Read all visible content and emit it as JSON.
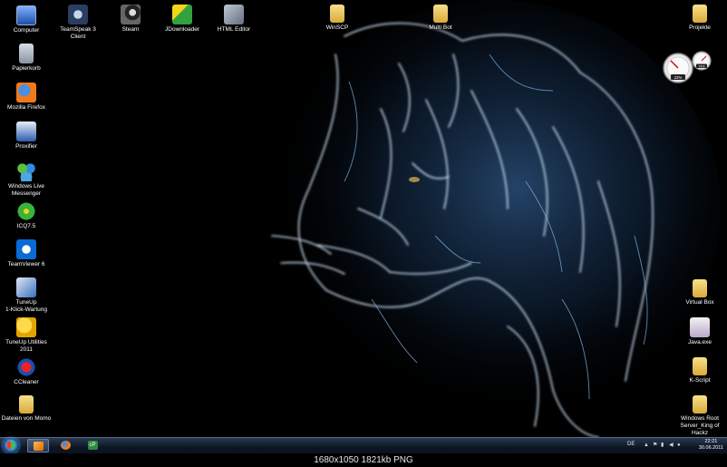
{
  "desktop_icons": [
    {
      "label": "Computer",
      "icon": "computer-icon"
    },
    {
      "label": "Papierkorb",
      "icon": "recycle-bin-icon"
    },
    {
      "label": "Mozilla Firefox",
      "icon": "firefox-icon"
    },
    {
      "label": "Proxifier",
      "icon": "proxifier-icon"
    },
    {
      "label": "Windows Live\nMessenger",
      "icon": "windows-live-messenger-icon"
    },
    {
      "label": "ICQ7.5",
      "icon": "icq-icon"
    },
    {
      "label": "TeamViewer 6",
      "icon": "teamviewer-icon"
    },
    {
      "label": "TuneUp\n1-Klick-Wartung",
      "icon": "tuneup-1click-icon"
    },
    {
      "label": "TuneUp Utilities 2011",
      "icon": "tuneup-utilities-icon"
    },
    {
      "label": "CCleaner",
      "icon": "ccleaner-icon"
    },
    {
      "label": "Dateien von Momo",
      "icon": "folder-icon"
    },
    {
      "label": "TeamSpeak 3 Client",
      "icon": "teamspeak-icon"
    },
    {
      "label": "Steam",
      "icon": "steam-icon"
    },
    {
      "label": "JDownloader",
      "icon": "jdownloader-icon"
    },
    {
      "label": "HTML Editor",
      "icon": "html-editor-icon"
    },
    {
      "label": "WinSCP",
      "icon": "folder-icon"
    },
    {
      "label": "Multi Bot",
      "icon": "multi-bot-icon"
    },
    {
      "label": "Projekte",
      "icon": "folder-icon"
    },
    {
      "label": "Virtual Box",
      "icon": "folder-icon"
    },
    {
      "label": "Java.exe",
      "icon": "exe-icon"
    },
    {
      "label": "K-Script",
      "icon": "folder-icon"
    },
    {
      "label": "Windows Root\nServer_King of Hackz",
      "icon": "folder-icon"
    }
  ],
  "gadget": {
    "cpu_percent": "22%",
    "ram_percent": "74%"
  },
  "taskbar": {
    "start_icon": "windows-start-orb",
    "pinned": [
      {
        "name": "media-player",
        "icon": "media-player-icon"
      },
      {
        "name": "firefox",
        "icon": "firefox-icon"
      },
      {
        "name": "cp-app",
        "icon": "cp-icon",
        "text": "cP"
      }
    ],
    "language": "DE",
    "clock_time": "22:21",
    "clock_date": "30.06.2011"
  },
  "caption": "1680x1050  1821kb  PNG"
}
